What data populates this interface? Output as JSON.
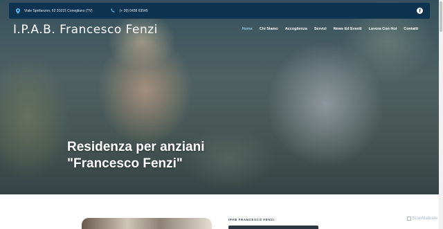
{
  "topbar": {
    "address": "Viale Spellanzon, 62 31015 Conegliano (TV)",
    "phone": "(+ 39) 0438 63545",
    "social_icon": "facebook-icon"
  },
  "brand": "I.P.A.B. Francesco Fenzi",
  "nav": {
    "items": [
      "Home",
      "Chi Siamo",
      "Accoglienza",
      "Servizi",
      "News Ed Eventi",
      "Lavora Con Noi",
      "Contatti"
    ],
    "active_color": "#8fc8f0"
  },
  "hero": {
    "line1": "Residenza per anziani",
    "line2": "\"Francesco Fenzi\""
  },
  "about": {
    "eyebrow": "IPAB FRANCESCO FENZI"
  },
  "watermark": "ScanMalware",
  "colors": {
    "topbar": "#0e3350",
    "nav_text": "#ffffff"
  }
}
